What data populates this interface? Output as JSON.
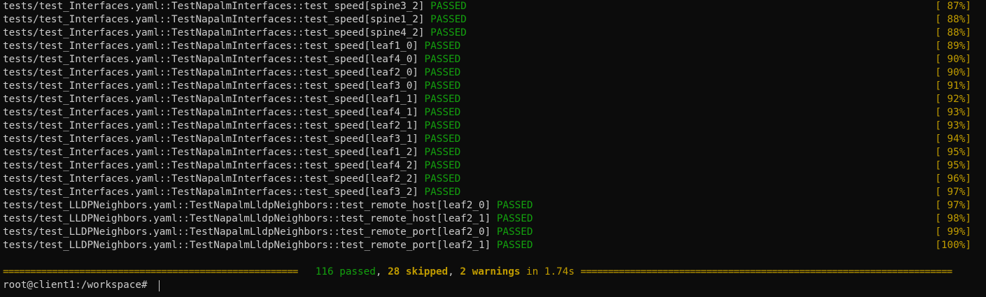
{
  "lines": [
    {
      "test": "tests/test_Interfaces.yaml::TestNapalmInterfaces::test_speed[spine3_2]",
      "status": "PASSED",
      "percent": "[ 87%]"
    },
    {
      "test": "tests/test_Interfaces.yaml::TestNapalmInterfaces::test_speed[spine1_2]",
      "status": "PASSED",
      "percent": "[ 88%]"
    },
    {
      "test": "tests/test_Interfaces.yaml::TestNapalmInterfaces::test_speed[spine4_2]",
      "status": "PASSED",
      "percent": "[ 88%]"
    },
    {
      "test": "tests/test_Interfaces.yaml::TestNapalmInterfaces::test_speed[leaf1_0]",
      "status": "PASSED",
      "percent": "[ 89%]"
    },
    {
      "test": "tests/test_Interfaces.yaml::TestNapalmInterfaces::test_speed[leaf4_0]",
      "status": "PASSED",
      "percent": "[ 90%]"
    },
    {
      "test": "tests/test_Interfaces.yaml::TestNapalmInterfaces::test_speed[leaf2_0]",
      "status": "PASSED",
      "percent": "[ 90%]"
    },
    {
      "test": "tests/test_Interfaces.yaml::TestNapalmInterfaces::test_speed[leaf3_0]",
      "status": "PASSED",
      "percent": "[ 91%]"
    },
    {
      "test": "tests/test_Interfaces.yaml::TestNapalmInterfaces::test_speed[leaf1_1]",
      "status": "PASSED",
      "percent": "[ 92%]"
    },
    {
      "test": "tests/test_Interfaces.yaml::TestNapalmInterfaces::test_speed[leaf4_1]",
      "status": "PASSED",
      "percent": "[ 93%]"
    },
    {
      "test": "tests/test_Interfaces.yaml::TestNapalmInterfaces::test_speed[leaf2_1]",
      "status": "PASSED",
      "percent": "[ 93%]"
    },
    {
      "test": "tests/test_Interfaces.yaml::TestNapalmInterfaces::test_speed[leaf3_1]",
      "status": "PASSED",
      "percent": "[ 94%]"
    },
    {
      "test": "tests/test_Interfaces.yaml::TestNapalmInterfaces::test_speed[leaf1_2]",
      "status": "PASSED",
      "percent": "[ 95%]"
    },
    {
      "test": "tests/test_Interfaces.yaml::TestNapalmInterfaces::test_speed[leaf4_2]",
      "status": "PASSED",
      "percent": "[ 95%]"
    },
    {
      "test": "tests/test_Interfaces.yaml::TestNapalmInterfaces::test_speed[leaf2_2]",
      "status": "PASSED",
      "percent": "[ 96%]"
    },
    {
      "test": "tests/test_Interfaces.yaml::TestNapalmInterfaces::test_speed[leaf3_2]",
      "status": "PASSED",
      "percent": "[ 97%]"
    },
    {
      "test": "tests/test_LLDPNeighbors.yaml::TestNapalmLldpNeighbors::test_remote_host[leaf2_0]",
      "status": "PASSED",
      "percent": "[ 97%]"
    },
    {
      "test": "tests/test_LLDPNeighbors.yaml::TestNapalmLldpNeighbors::test_remote_host[leaf2_1]",
      "status": "PASSED",
      "percent": "[ 98%]"
    },
    {
      "test": "tests/test_LLDPNeighbors.yaml::TestNapalmLldpNeighbors::test_remote_port[leaf2_0]",
      "status": "PASSED",
      "percent": "[ 99%]"
    },
    {
      "test": "tests/test_LLDPNeighbors.yaml::TestNapalmLldpNeighbors::test_remote_port[leaf2_1]",
      "status": "PASSED",
      "percent": "[100%]"
    }
  ],
  "summary": {
    "passed": "116 passed",
    "sep1": ", ",
    "skipped": "28 skipped",
    "sep2": ", ",
    "warnings": "2 warnings",
    "timing": " in 1.74s ",
    "rule_left": "======================================================",
    "rule_right": "===================================================================="
  },
  "prompt": {
    "text": "root@client1:/workspace# "
  },
  "colors": {
    "background": "#0c0c0c",
    "text": "#cccccc",
    "passed": "#13a10e",
    "percent": "#c19c00"
  }
}
